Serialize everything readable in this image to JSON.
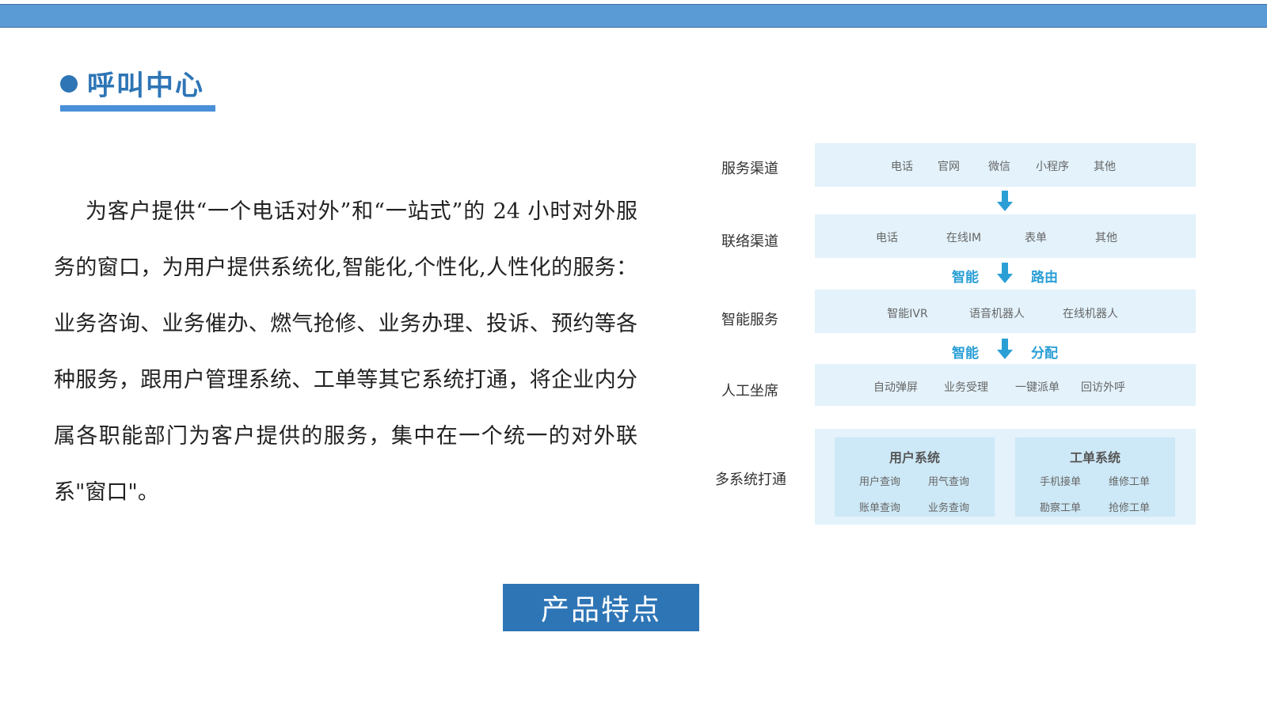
{
  "section": {
    "title": "呼叫中心"
  },
  "paragraph": "为客户提供“一个电话对外”和“一站式”的 24 小时对外服务的窗口，为用户提供系统化,智能化,个性化,人性化的服务：业务咨询、业务催办、燃气抢修、业务办理、投诉、预约等各种服务，跟用户管理系统、工单等其它系统打通，将企业内分属各职能部门为客户提供的服务，集中在一个统一的对外联系\"窗口\"。",
  "diagram": {
    "service_channel": {
      "label": "服务渠道",
      "items": [
        "电话",
        "官网",
        "微信",
        "小程序",
        "其他"
      ]
    },
    "contact_channel": {
      "label": "联络渠道",
      "items": [
        "电话",
        "在线IM",
        "表单",
        "其他"
      ]
    },
    "routing": {
      "left": "智能",
      "right": "路由"
    },
    "smart_service": {
      "label": "智能服务",
      "items": [
        "智能IVR",
        "语音机器人",
        "在线机器人"
      ]
    },
    "dispatch": {
      "left": "智能",
      "right": "分配"
    },
    "agent": {
      "label": "人工坐席",
      "items": [
        "自动弹屏",
        "业务受理",
        "一键派单",
        "回访外呼"
      ]
    },
    "integration": {
      "label": "多系统打通",
      "user_system": {
        "title": "用户系统",
        "items": [
          "用户查询",
          "用气查询",
          "账单查询",
          "业务查询"
        ]
      },
      "workorder_system": {
        "title": "工单系统",
        "items": [
          "手机接单",
          "维修工单",
          "勘察工单",
          "抢修工单"
        ]
      }
    }
  },
  "feature_button": {
    "label": "产品特点"
  },
  "colors": {
    "top_bar": "#5b9bd5",
    "accent": "#2e75b6",
    "band": "#e3f2fb",
    "arrow": "#2a9fd6"
  }
}
